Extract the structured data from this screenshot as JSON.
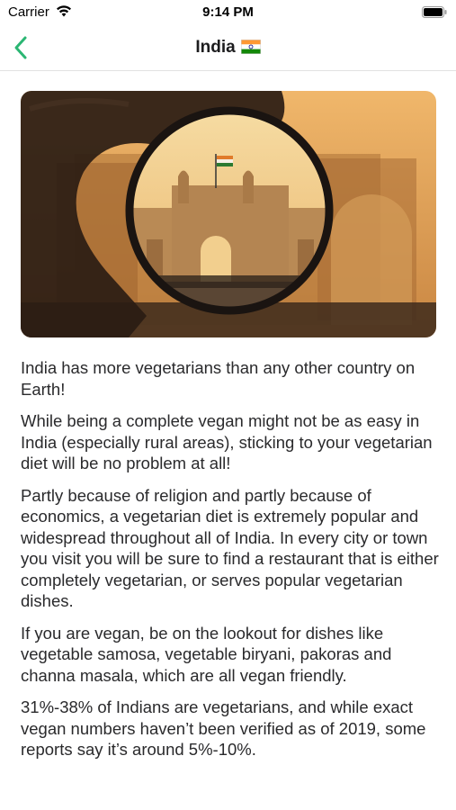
{
  "status": {
    "carrier": "Carrier",
    "time": "9:14 PM",
    "wifi_icon": "wifi-icon",
    "battery_icon": "battery-icon"
  },
  "nav": {
    "title": "India",
    "flag_icon": "india-flag-icon",
    "back_icon": "chevron-left-icon",
    "accent": "#2bb673"
  },
  "hero": {
    "image": "gateway-of-india-through-lens"
  },
  "paragraphs": [
    "India has more vegetarians than any other country on Earth!",
    "While being a complete vegan might not be as easy in India (especially rural areas), sticking to your vegetarian diet will be no problem at all!",
    "Partly because of religion and partly because of economics, a vegetarian diet is extremely popular and widespread throughout all of India. In every city or town you visit you will be sure to find a restaurant that is either completely vegetarian, or serves popular vegetarian dishes.",
    "If you are vegan, be on the lookout for dishes like vegetable samosa, vegetable biryani, pakoras and channa masala, which are all vegan friendly.",
    "31%-38% of Indians are vegetarians, and while exact vegan numbers haven’t been verified as of 2019, some reports say it’s around 5%-10%."
  ]
}
